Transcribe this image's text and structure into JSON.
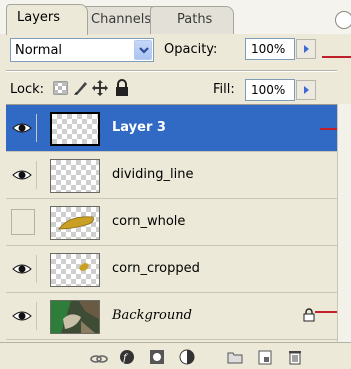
{
  "tabs": [
    {
      "label": "Layers",
      "active": true
    },
    {
      "label": "Channels",
      "active": false
    },
    {
      "label": "Paths",
      "active": false
    }
  ],
  "blend_mode": {
    "value": "Normal"
  },
  "opacity": {
    "label": "Opacity:",
    "value": "100%"
  },
  "lock": {
    "label": "Lock:",
    "icons": [
      "lock-transparent-pixels-icon",
      "lock-image-pixels-icon",
      "lock-position-icon",
      "lock-all-icon"
    ]
  },
  "fill": {
    "label": "Fill:",
    "value": "100%"
  },
  "layers": [
    {
      "name": "Layer 3",
      "visible": true,
      "selected": true,
      "thumb": "empty"
    },
    {
      "name": "dividing_line",
      "visible": true,
      "selected": false,
      "thumb": "empty"
    },
    {
      "name": "corn_whole",
      "visible": false,
      "selected": false,
      "thumb": "corn-whole"
    },
    {
      "name": "corn_cropped",
      "visible": true,
      "selected": false,
      "thumb": "corn-cropped"
    },
    {
      "name": "Background",
      "visible": true,
      "selected": false,
      "thumb": "photo",
      "locked": true,
      "italic": true
    }
  ],
  "bottom_icons": [
    "link-layers-icon",
    "layer-style-icon",
    "add-mask-icon",
    "adjustment-layer-icon",
    "new-group-icon",
    "new-layer-icon",
    "delete-layer-icon"
  ],
  "colors": {
    "selection": "#316ac5",
    "annotation_line": "#c0202a",
    "panel_bg": "#ece9d8"
  }
}
